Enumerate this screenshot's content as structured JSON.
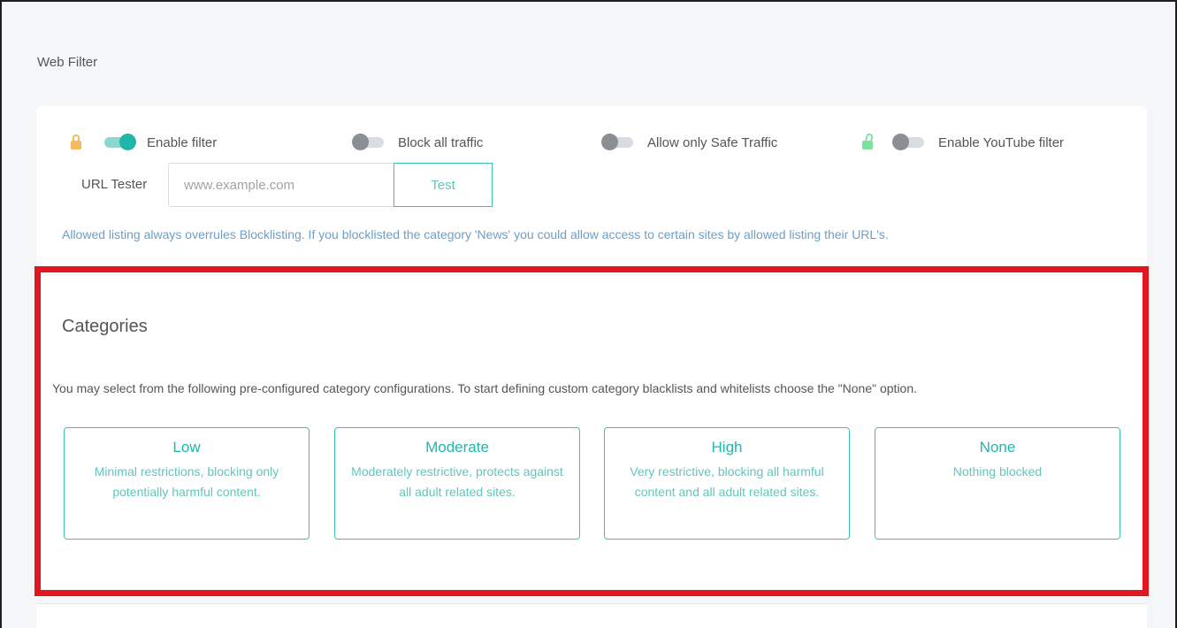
{
  "page": {
    "title": "Web Filter"
  },
  "filters": {
    "enable_filter": {
      "label": "Enable filter",
      "state": "on",
      "lock_color": "#f5b95f"
    },
    "block_all": {
      "label": "Block all traffic",
      "state": "off"
    },
    "safe_traffic": {
      "label": "Allow only Safe Traffic",
      "state": "off"
    },
    "youtube": {
      "label": "Enable YouTube filter",
      "state": "off",
      "lock_color": "#7ee0a0"
    }
  },
  "url_tester": {
    "label": "URL Tester",
    "placeholder": "www.example.com",
    "button": "Test"
  },
  "info": "Allowed listing always overrules Blocklisting. If you blocklisted the category 'News' you could allow access to certain sites by allowed listing their URL's.",
  "categories": {
    "title": "Categories",
    "description": "You may select from the following pre-configured category configurations. To start defining custom category blacklists and whitelists choose the \"None\" option.",
    "options": [
      {
        "title": "Low",
        "text": "Minimal restrictions, blocking only potentially harmful content."
      },
      {
        "title": "Moderate",
        "text": "Moderately restrictive, protects against all adult related sites."
      },
      {
        "title": "High",
        "text": "Very restrictive, blocking all harmful content and all adult related sites."
      },
      {
        "title": "None",
        "text": "Nothing blocked"
      }
    ]
  },
  "colors": {
    "accent": "#20b7a8",
    "highlight": "#e3161f",
    "info_text": "#6c9fc7"
  }
}
